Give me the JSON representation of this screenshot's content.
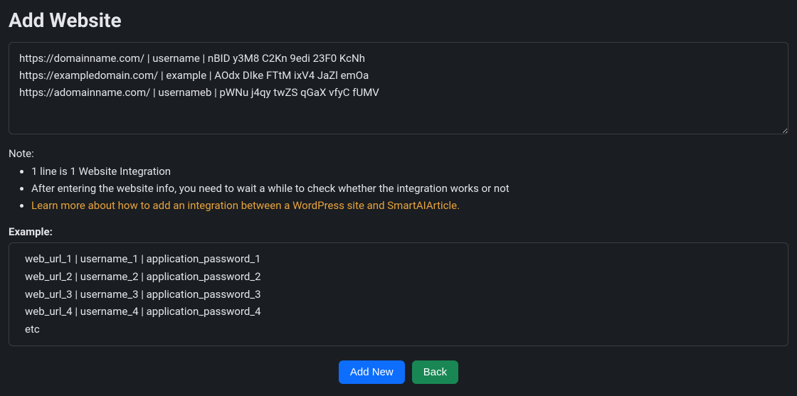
{
  "title": "Add Website",
  "textarea": {
    "value": "https://domainname.com/ | username | nBID y3M8 C2Kn 9edi 23F0 KcNh\nhttps://exampledomain.com/ | example | AOdx DIke FTtM ixV4 JaZl emOa\nhttps://adomainname.com/ | usernameb | pWNu j4qy twZS qGaX vfyC fUMV"
  },
  "note": {
    "label": "Note:",
    "items": [
      "1 line is 1 Website Integration",
      "After entering the website info, you need to wait a while to check whether the integration works or not"
    ],
    "link_text": "Learn more about how to add an integration between a WordPress site and SmartAIArticle."
  },
  "example": {
    "label": "Example:",
    "lines": [
      "web_url_1 | username_1 | application_password_1",
      "web_url_2 | username_2 | application_password_2",
      "web_url_3 | username_3 | application_password_3",
      "web_url_4 | username_4 | application_password_4",
      "etc"
    ]
  },
  "buttons": {
    "add_new": "Add New",
    "back": "Back"
  }
}
